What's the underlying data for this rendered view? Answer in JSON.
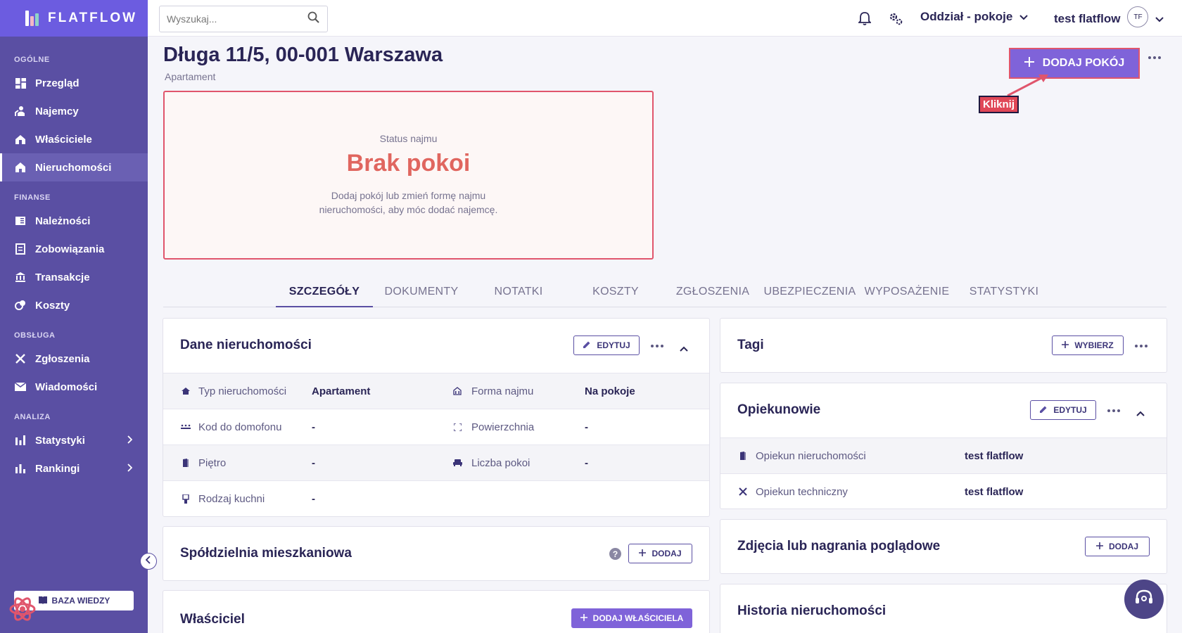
{
  "app": {
    "logo_text": "FLATFLOW"
  },
  "search": {
    "placeholder": "Wyszukaj..."
  },
  "topbar": {
    "branch": "Oddział - pokoje",
    "user_name": "test flatflow",
    "user_initials": "TF"
  },
  "sidebar": {
    "sections": [
      {
        "title": "OGÓLNE",
        "items": [
          {
            "label": "Przegląd",
            "icon": "dashboard-icon"
          },
          {
            "label": "Najemcy",
            "icon": "tenants-icon"
          },
          {
            "label": "Właściciele",
            "icon": "owners-icon"
          },
          {
            "label": "Nieruchomości",
            "icon": "property-icon",
            "active": true
          }
        ]
      },
      {
        "title": "FINANSE",
        "items": [
          {
            "label": "Należności",
            "icon": "receivables-icon"
          },
          {
            "label": "Zobowiązania",
            "icon": "liabilities-icon"
          },
          {
            "label": "Transakcje",
            "icon": "bank-icon"
          },
          {
            "label": "Koszty",
            "icon": "costs-icon"
          }
        ]
      },
      {
        "title": "OBSŁUGA",
        "items": [
          {
            "label": "Zgłoszenia",
            "icon": "tools-icon"
          },
          {
            "label": "Wiadomości",
            "icon": "mail-icon"
          }
        ]
      },
      {
        "title": "ANALIZA",
        "items": [
          {
            "label": "Statystyki",
            "icon": "stats-icon",
            "expandable": true
          },
          {
            "label": "Rankingi",
            "icon": "ranking-icon",
            "expandable": true
          }
        ]
      }
    ],
    "knowledge_base": "BAZA WIEDZY"
  },
  "page": {
    "title": "Długa 11/5, 00-001 Warszawa",
    "subtitle": "Apartament",
    "add_room": "DODAJ POKÓJ",
    "click_hint": "Kliknij"
  },
  "status": {
    "label": "Status najmu",
    "value": "Brak pokoi",
    "description": "Dodaj pokój lub zmień formę najmu nieruchomości, aby móc dodać najemcę."
  },
  "tabs": [
    "SZCZEGÓŁY",
    "DOKUMENTY",
    "NOTATKI",
    "KOSZTY",
    "ZGŁOSZENIA",
    "UBEZPIECZENIA",
    "WYPOSAŻENIE",
    "STATYSTYKI"
  ],
  "property_card": {
    "title": "Dane nieruchomości",
    "edit": "EDYTUJ",
    "rows": [
      {
        "label1": "Typ nieruchomości",
        "value1": "Apartament",
        "label2": "Forma najmu",
        "value2": "Na pokoje"
      },
      {
        "label1": "Kod do domofonu",
        "value1": "-",
        "label2": "Powierzchnia",
        "value2": "-"
      },
      {
        "label1": "Piętro",
        "value1": "-",
        "label2": "Liczba pokoi",
        "value2": "-"
      },
      {
        "label1": "Rodzaj kuchni",
        "value1": "-"
      }
    ]
  },
  "coop_card": {
    "title": "Spółdzielnia mieszkaniowa",
    "add": "DODAJ"
  },
  "owner_card": {
    "title": "Właściciel",
    "add": "DODAJ WŁAŚCICIELA"
  },
  "tags_card": {
    "title": "Tagi",
    "select": "WYBIERZ"
  },
  "keepers_card": {
    "title": "Opiekunowie",
    "edit": "EDYTUJ",
    "rows": [
      {
        "label": "Opiekun nieruchomości",
        "value": "test flatflow"
      },
      {
        "label": "Opiekun techniczny",
        "value": "test flatflow"
      }
    ]
  },
  "photos_card": {
    "title": "Zdjęcia lub nagrania poglądowe",
    "add": "DODAJ"
  },
  "history_card": {
    "title": "Historia nieruchomości"
  },
  "colors": {
    "accent": "#7f63d9",
    "sidebar": "#5a4fa3",
    "danger": "#e0556c"
  }
}
